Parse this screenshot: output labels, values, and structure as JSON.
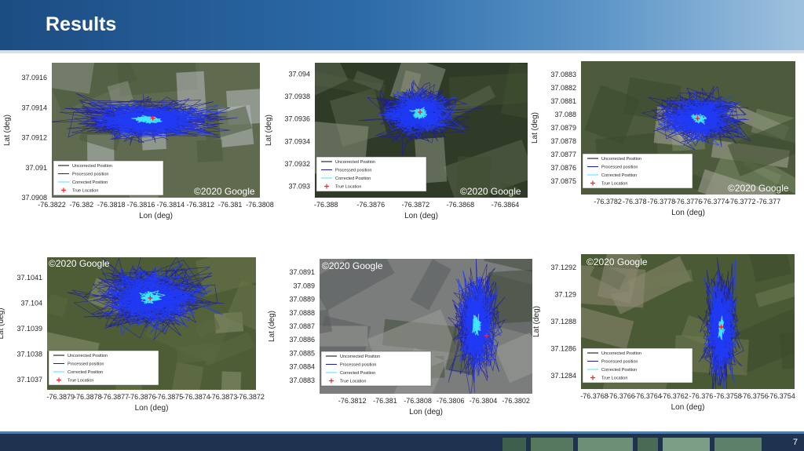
{
  "slide": {
    "title": "Results",
    "page_number": "7",
    "colors": {
      "header": "#2c6aa8",
      "footer": "#1f3350"
    }
  },
  "chart_data": [
    {
      "type": "scatter",
      "xlabel": "Lon (deg)",
      "ylabel": "Lat (deg)",
      "xlim": [
        -76.3822,
        -76.3808
      ],
      "ylim": [
        37.0908,
        37.0917
      ],
      "xticks": [
        "-76.3822",
        "-76.382",
        "-76.3818",
        "-76.3816",
        "-76.3814",
        "-76.3812",
        "-76.381",
        "-76.3808"
      ],
      "yticks": [
        "37.0908",
        "37.091",
        "37.0912",
        "37.0914",
        "37.0916"
      ],
      "legend": [
        "Uncorrected Position",
        "Processed position",
        "Corrected Position",
        "True Location"
      ],
      "legend_position": "bottom-left",
      "cloud_center": [
        -76.38155,
        37.09132
      ],
      "cloud_spread": [
        0.00045,
        0.00012
      ],
      "true_location": [
        -76.38152,
        37.09133
      ],
      "annotation": "©2020 Google"
    },
    {
      "type": "scatter",
      "xlabel": "Lon (deg)",
      "ylabel": "Lat (deg)",
      "xlim": [
        -76.3881,
        -76.3862
      ],
      "ylim": [
        37.0929,
        37.0941
      ],
      "xticks": [
        "-76.388",
        "-76.3876",
        "-76.3872",
        "-76.3868",
        "-76.3864"
      ],
      "yticks": [
        "37.093",
        "37.0932",
        "37.0934",
        "37.0936",
        "37.0938",
        "37.094"
      ],
      "legend": [
        "Uncorrected Position",
        "Processed position",
        "Corrected Position",
        "True Location"
      ],
      "legend_position": "bottom-left",
      "cloud_center": [
        -76.38716,
        37.09365
      ],
      "cloud_spread": [
        0.00035,
        0.00022
      ],
      "true_location": [
        -76.38716,
        37.09366
      ],
      "annotation": "©2020 Google"
    },
    {
      "type": "scatter",
      "xlabel": "Lon (deg)",
      "ylabel": "Lat (deg)",
      "xlim": [
        -76.3784,
        -76.3768
      ],
      "ylim": [
        37.0874,
        37.0884
      ],
      "xticks": [
        "-76.3782",
        "-76.378",
        "-76.3778",
        "-76.3776",
        "-76.3774",
        "-76.3772",
        "-76.377"
      ],
      "yticks": [
        "37.0875",
        "37.0876",
        "37.0877",
        "37.0878",
        "37.0879",
        "37.088",
        "37.0881",
        "37.0882",
        "37.0883"
      ],
      "legend": [
        "Uncorrected Position",
        "Processed position",
        "Corrected Position",
        "True Location"
      ],
      "legend_position": "bottom-left",
      "cloud_center": [
        -76.37752,
        37.08797
      ],
      "cloud_spread": [
        0.0003,
        0.00017
      ],
      "true_location": [
        -76.37753,
        37.08797
      ],
      "annotation": "©2020 Google"
    },
    {
      "type": "scatter",
      "xlabel": "Lon (deg)",
      "ylabel": "Lat (deg)",
      "xlim": [
        -76.38795,
        -76.38718
      ],
      "ylim": [
        37.10366,
        37.10418
      ],
      "xticks": [
        "-76.3879",
        "-76.3878",
        "-76.3877",
        "-76.3876",
        "-76.3875",
        "-76.3874",
        "-76.3873",
        "-76.3872"
      ],
      "yticks": [
        "37.1037",
        "37.1038",
        "37.1039",
        "37.104",
        "37.1041"
      ],
      "legend": [
        "Uncorrected Position",
        "Processed position",
        "Corrected Position",
        "True Location"
      ],
      "legend_position": "bottom-left",
      "cloud_center": [
        -76.38757,
        37.10402
      ],
      "cloud_spread": [
        0.0002,
        0.00012
      ],
      "true_location": [
        -76.38757,
        37.10402
      ],
      "annotation": "©2020 Google"
    },
    {
      "type": "scatter",
      "xlabel": "Lon (deg)",
      "ylabel": "Lat (deg)",
      "xlim": [
        -76.3814,
        -76.3801
      ],
      "ylim": [
        37.0882,
        37.0892
      ],
      "xticks": [
        "-76.3812",
        "-76.381",
        "-76.3808",
        "-76.3806",
        "-76.3804",
        "-76.3802"
      ],
      "yticks": [
        "37.0883",
        "37.0884",
        "37.0885",
        "37.0886",
        "37.0887",
        "37.0888",
        "37.0889",
        "37.089",
        "37.0891"
      ],
      "legend": [
        "Uncorrected Position",
        "Processed position",
        "Corrected Position",
        "True Location"
      ],
      "legend_position": "bottom-left",
      "cloud_center": [
        -76.38044,
        37.08871
      ],
      "cloud_spread": [
        0.00012,
        0.00035
      ],
      "true_location": [
        -76.38038,
        37.08863
      ],
      "annotation": "©2020 Google"
    },
    {
      "type": "scatter",
      "xlabel": "Lon (deg)",
      "ylabel": "Lat (deg)",
      "xlim": [
        -76.3769,
        -76.3753
      ],
      "ylim": [
        37.1283,
        37.1293
      ],
      "xticks": [
        "-76.3768",
        "-76.3766",
        "-76.3764",
        "-76.3762",
        "-76.376",
        "-76.3758",
        "-76.3756",
        "-76.3754"
      ],
      "yticks": [
        "37.1284",
        "37.1286",
        "37.1288",
        "37.129",
        "37.1292"
      ],
      "legend": [
        "Uncorrected Position",
        "Processed position",
        "Corrected Position",
        "True Location"
      ],
      "legend_position": "bottom-left",
      "cloud_center": [
        -76.37585,
        37.12875
      ],
      "cloud_spread": [
        0.00012,
        0.00038
      ],
      "true_location": [
        -76.37585,
        37.12876
      ],
      "annotation": "©2020 Google"
    }
  ]
}
